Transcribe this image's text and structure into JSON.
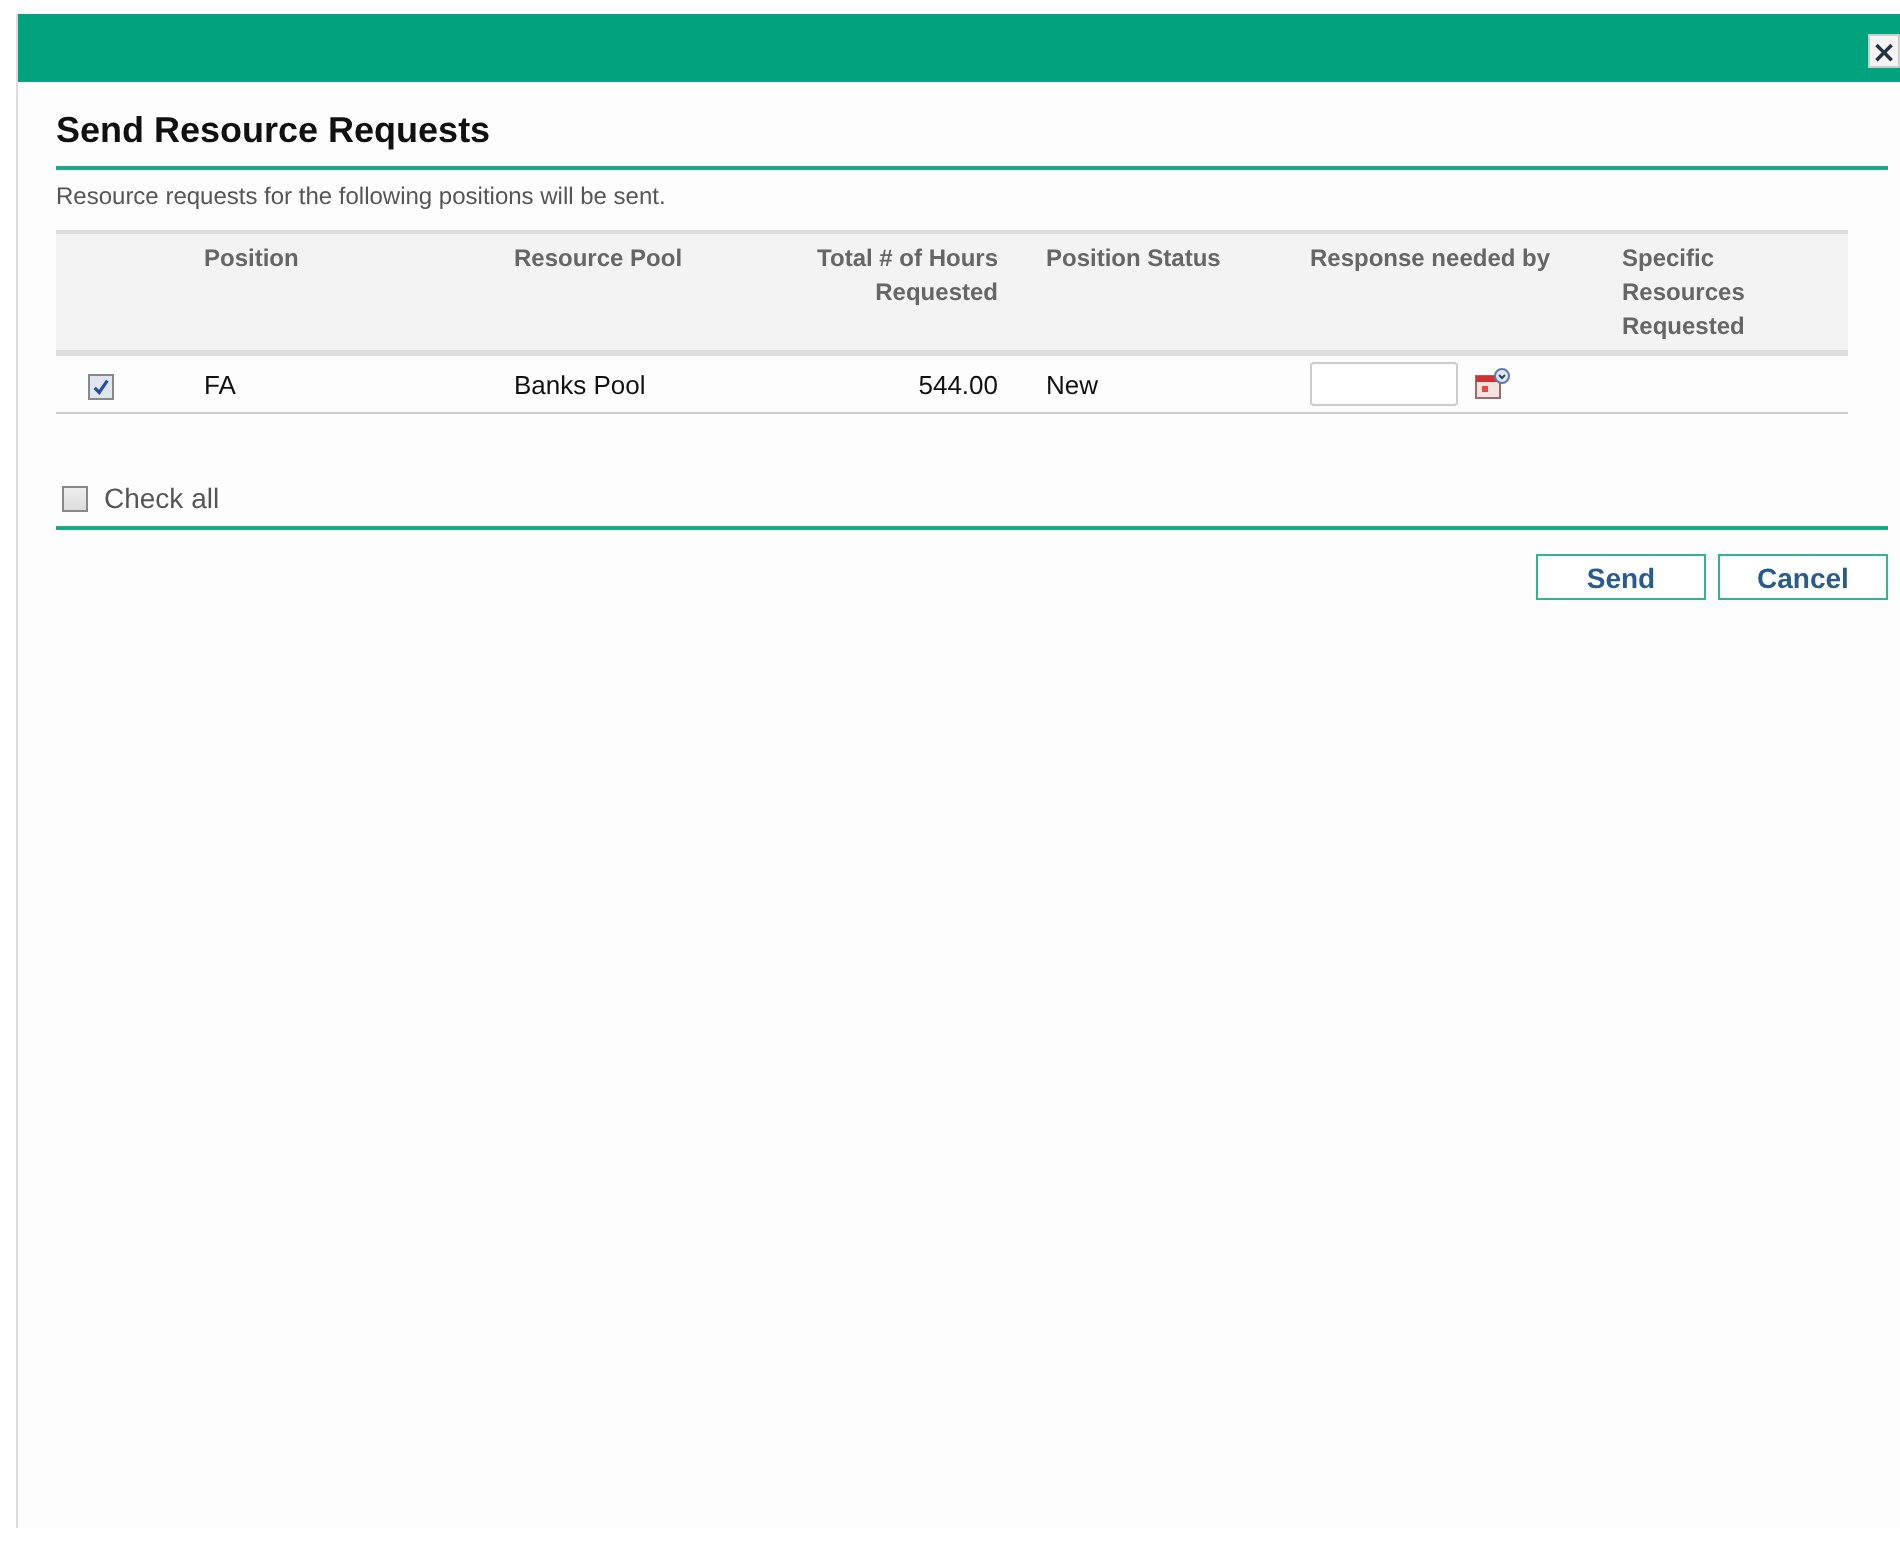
{
  "dialog": {
    "close": "×",
    "title": "Send Resource Requests",
    "description": "Resource requests for the following positions will be sent."
  },
  "table": {
    "columns": [
      "Position",
      "Resource Pool",
      "Total # of Hours Requested",
      "Position Status",
      "Response needed by",
      "Specific Resources Requested"
    ],
    "rows": [
      {
        "checked": true,
        "position": "FA",
        "resource_pool": "Banks Pool",
        "hours": "544.00",
        "status": "New"
      }
    ]
  },
  "check_all": {
    "label": "Check all",
    "checked": false
  },
  "buttons": [
    {
      "label": "Send"
    },
    {
      "label": "Cancel"
    }
  ]
}
